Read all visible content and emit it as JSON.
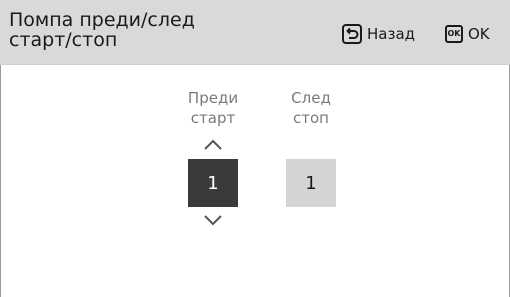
{
  "header": {
    "title_line1": "Помпа преди/след",
    "title_line2": "старт/стоп",
    "back_icon": "back-return-icon",
    "back_label": "Назад",
    "ok_icon_text": "OK",
    "ok_label": "OK"
  },
  "columns": [
    {
      "label_line1": "Преди",
      "label_line2": "старт",
      "value": "1",
      "selected": true
    },
    {
      "label_line1": "След",
      "label_line2": "стоп",
      "value": "1",
      "selected": false
    }
  ],
  "colors": {
    "header_bg": "#d9d9d9",
    "selected_bg": "#3a3a3a",
    "unselected_bg": "#d4d4d4",
    "label_color": "#7a7a7a"
  }
}
